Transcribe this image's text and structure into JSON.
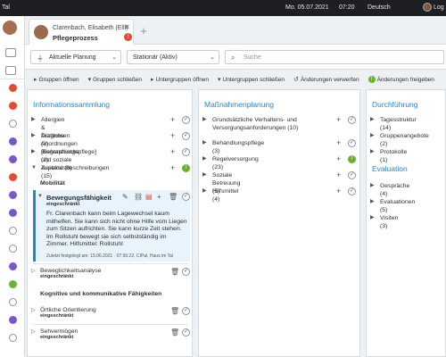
{
  "topbar": {
    "app": "Tal",
    "date": "Mo. 05.07.2021",
    "time": "07:20",
    "language": "Deutsch",
    "account": "Log"
  },
  "tab": {
    "patient": "Clarenbach, Elisabeth (Elli)",
    "title": "Pflegeprozess",
    "alert": "!",
    "close": "✕",
    "new": "+"
  },
  "filters": {
    "planning": "Aktuelle Planung",
    "stay": "Stationär (Aktiv)",
    "search_placeholder": "Suche"
  },
  "toolbar": {
    "open_groups": "Gruppen öffnen",
    "close_groups": "Gruppen schließen",
    "open_subgroups": "Untergruppen öffnen",
    "close_subgroups": "Untergruppen schließen",
    "discard": "Änderungen verwerfen",
    "release": "Änderungen freigeben"
  },
  "info": {
    "heading": "Informationssammlung",
    "items": [
      "Allergien & Diagnosen (3)",
      "Ärztliche Anordnungen [Behandlungspflege] (2)",
      "Biographische und soziale Aspekte (8)",
      "Zustandsbeschreibungen (15)"
    ],
    "section_mobility": "Mobilität",
    "selected": {
      "title": "Bewegungsfähigkeit",
      "status": "eingeschränkt",
      "text": "Fr. Clarenbach kann beim Lagewechsel kaum mithelfen. Sie kann sich nicht ohne Hilfe vom Liegen zum Sitzen aufrichten. Sie kann kurze Zeit stehen. Im Rollstuhl bewegt sie sich selbstständig im Zimmer. Hilfsmittel: Rollstuhl",
      "meta": "Zuletzt festgelegt am: 15.06.2021 · 07:56:22, CIPal, Haus im Tal"
    },
    "item_analysis": {
      "title": "Beweglichkeitsanalyse",
      "status": "eingeschränkt"
    },
    "section_cognitive": "Kognitive und kommunikative Fähigkeiten",
    "item_orientation": {
      "title": "Örtliche Orientierung",
      "status": "eingeschränkt"
    },
    "item_vision": {
      "title": "Sehvermögen",
      "status": "eingeschränkt"
    }
  },
  "measures": {
    "heading": "Maßnahmenplanung",
    "items": [
      "Grundsätzliche Verhaltens- und Versorgungsanforderungen (10)",
      "Behandlungspflege (3)",
      "Regelversorgung (23)",
      "Soziale Betreuung (5)",
      "Hilfsmittel (4)"
    ]
  },
  "execution": {
    "heading": "Durchführung",
    "items": [
      "Tagesstruktur (14)",
      "Gruppenangebote (2)",
      "Protokolle (1)"
    ],
    "eval_heading": "Evaluation",
    "eval_items": [
      "Gespräche (4)",
      "Evaluationen (5)",
      "Visiten (3)"
    ]
  },
  "colors": {
    "accent": "#2585c9",
    "alert": "#e2492f",
    "ok": "#6ab42d",
    "purple": "#7b56c9"
  }
}
